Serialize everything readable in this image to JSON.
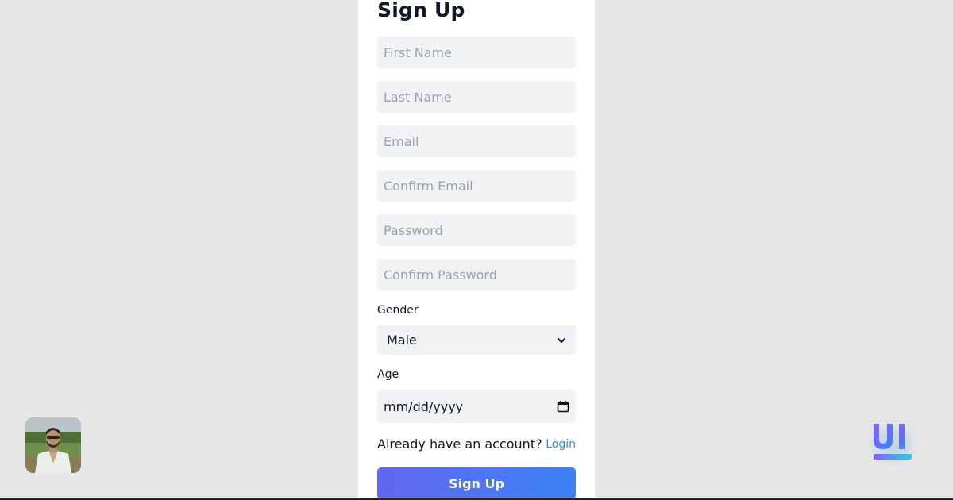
{
  "form": {
    "title": "Sign Up",
    "fields": {
      "first_name": {
        "placeholder": "First Name",
        "value": ""
      },
      "last_name": {
        "placeholder": "Last Name",
        "value": ""
      },
      "email": {
        "placeholder": "Email",
        "value": ""
      },
      "confirm_email": {
        "placeholder": "Confirm Email",
        "value": ""
      },
      "password": {
        "placeholder": "Password",
        "value": ""
      },
      "confirm_password": {
        "placeholder": "Confirm Password",
        "value": ""
      }
    },
    "gender": {
      "label": "Gender",
      "selected": "Male"
    },
    "age": {
      "label": "Age",
      "placeholder": "mm/dd/yyyy"
    },
    "account_prompt": "Already have an account?",
    "login_link": "Login",
    "submit_label": "Sign Up"
  },
  "colors": {
    "background": "#e6e6e6",
    "card": "#ffffff",
    "input_bg": "#f1f2f4",
    "link": "#3b82f6",
    "button_gradient_start": "#6366f1",
    "button_gradient_end": "#3b82f6",
    "logo_gradient_start": "#8b5cf6",
    "logo_gradient_end": "#22d3ee"
  },
  "icons": {
    "select_arrow": "chevron-down-icon",
    "date_picker": "calendar-icon",
    "brand": "ui-logo-icon"
  }
}
